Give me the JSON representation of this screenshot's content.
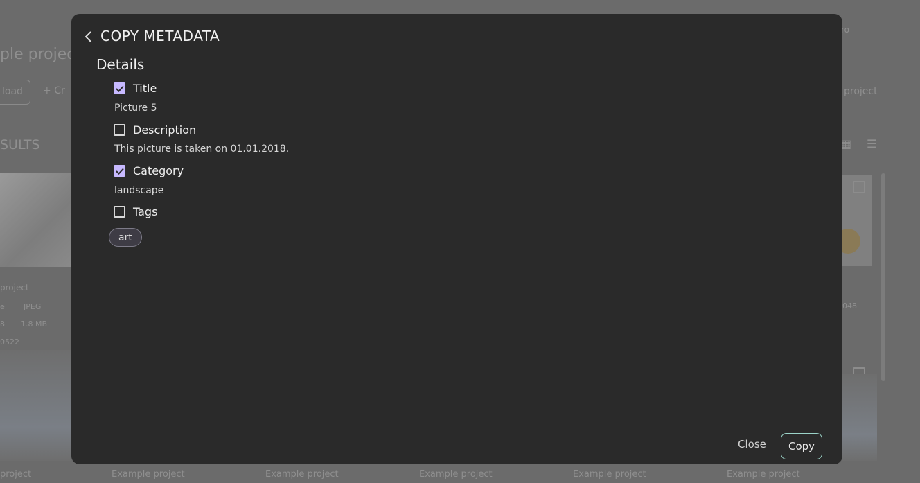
{
  "background": {
    "project_title": "ple project",
    "upload_label": "load",
    "create_label": "Cr",
    "project_link": "project",
    "results_label": "SULTS",
    "card_meta": [
      "project",
      "e",
      "JPEG",
      "8",
      "1.8 MB",
      "0522"
    ],
    "card_size": "048",
    "footer_items": [
      "project",
      "Example project",
      "Example project",
      "Example project",
      "Example project",
      "Example project"
    ],
    "top_right_label": "ro"
  },
  "modal": {
    "title": "COPY METADATA",
    "section_title": "Details",
    "fields": [
      {
        "label": "Title",
        "checked": true,
        "value": "Picture 5"
      },
      {
        "label": "Description",
        "checked": false,
        "value": "This picture is taken on 01.01.2018."
      },
      {
        "label": "Category",
        "checked": true,
        "value": "landscape"
      },
      {
        "label": "Tags",
        "checked": false
      }
    ],
    "tags": [
      "art"
    ],
    "close_label": "Close",
    "copy_label": "Copy"
  },
  "colors": {
    "accent": "#c7b9ff",
    "copy_border": "#9bd3c8",
    "modal_bg": "#2a2a2a"
  }
}
